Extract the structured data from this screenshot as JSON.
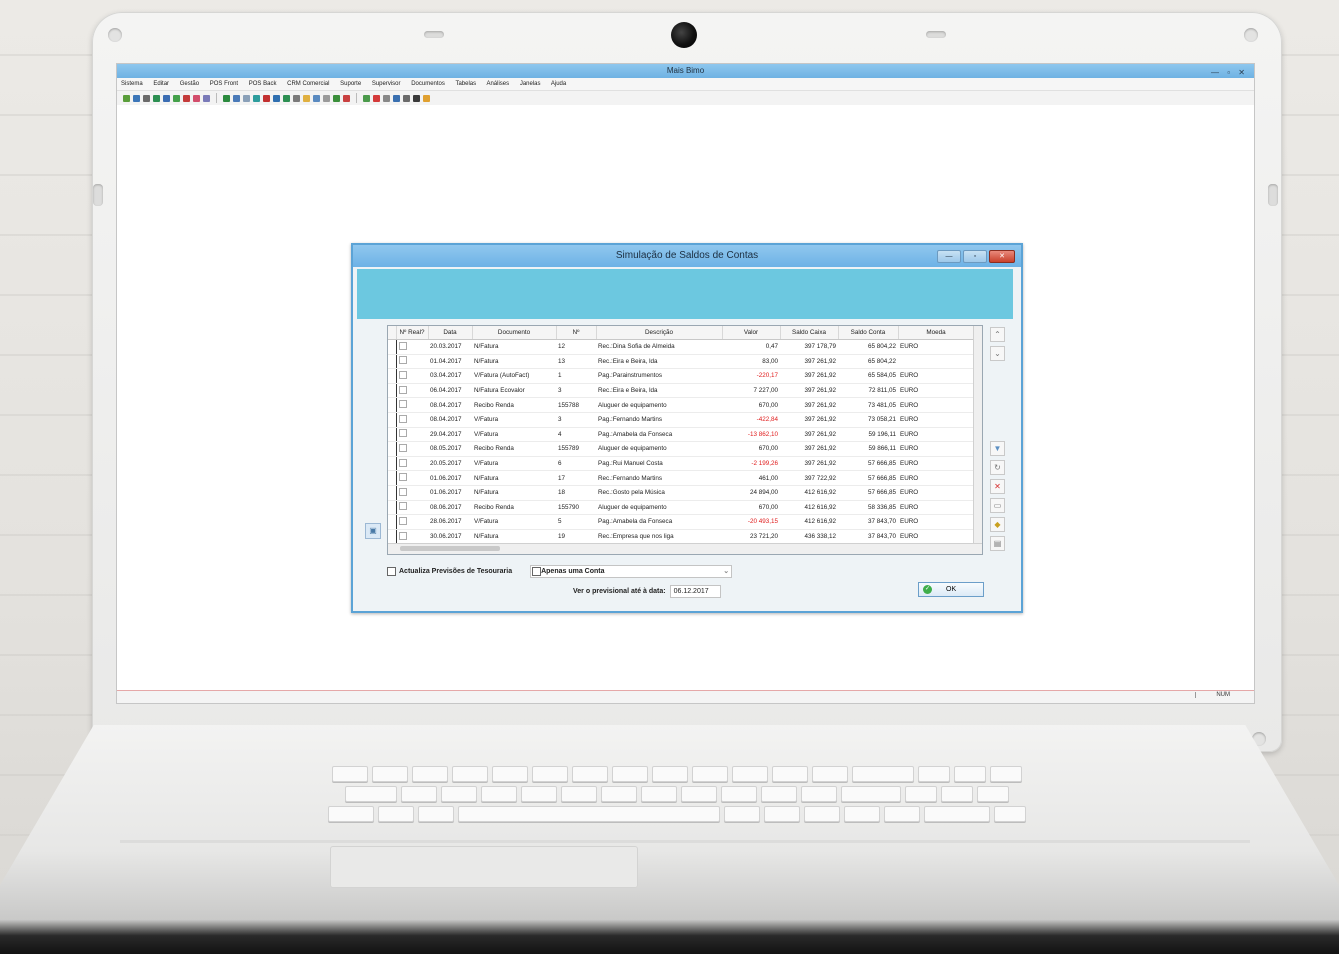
{
  "app": {
    "title": "Mais Bimo",
    "window_controls": "— ▫ ✕",
    "menu": [
      "Sistema",
      "Editar",
      "Gestão",
      "POS Front",
      "POS Back",
      "CRM Comercial",
      "Suporte",
      "Supervisor",
      "Documentos",
      "Tabelas",
      "Análises",
      "Janelas",
      "Ajuda"
    ],
    "status_right": "NUM"
  },
  "dialog": {
    "title": "Simulação de Saldos de Contas",
    "controls": {
      "minimize": "—",
      "maximize": "▫",
      "close": "✕"
    },
    "columns": [
      "Nº Real?",
      "Data",
      "Documento",
      "Nº",
      "Descrição",
      "Valor",
      "Saldo Caixa",
      "Saldo Conta",
      "Moeda"
    ],
    "rows": [
      {
        "data": "20.03.2017",
        "documento": "N/Fatura",
        "numero": "12",
        "descricao": "Rec.:Dina Sofia de Almeida",
        "valor": "0,47",
        "saldo_caixa": "397 178,79",
        "saldo_conta": "65 804,22",
        "moeda": "EURO",
        "neg": false
      },
      {
        "data": "01.04.2017",
        "documento": "N/Fatura",
        "numero": "13",
        "descricao": "Rec.:Eira e Beira, lda",
        "valor": "83,00",
        "saldo_caixa": "397 261,92",
        "saldo_conta": "65 804,22",
        "moeda": "",
        "neg": false
      },
      {
        "data": "03.04.2017",
        "documento": "V/Fatura (AutoFact)",
        "numero": "1",
        "descricao": "Pag.:Parainstrumentos",
        "valor": "-220,17",
        "saldo_caixa": "397 261,92",
        "saldo_conta": "65 584,05",
        "moeda": "EURO",
        "neg": true
      },
      {
        "data": "06.04.2017",
        "documento": "N/Fatura Ecovalor",
        "numero": "3",
        "descricao": "Rec.:Eira e Beira, lda",
        "valor": "7 227,00",
        "saldo_caixa": "397 261,92",
        "saldo_conta": "72 811,05",
        "moeda": "EURO",
        "neg": false
      },
      {
        "data": "08.04.2017",
        "documento": "Recibo Renda",
        "numero": "155788",
        "descricao": "Aluguer de equipamento",
        "valor": "670,00",
        "saldo_caixa": "397 261,92",
        "saldo_conta": "73 481,05",
        "moeda": "EURO",
        "neg": false
      },
      {
        "data": "08.04.2017",
        "documento": "V/Fatura",
        "numero": "3",
        "descricao": "Pag.:Fernando Martins",
        "valor": "-422,84",
        "saldo_caixa": "397 261,92",
        "saldo_conta": "73 058,21",
        "moeda": "EURO",
        "neg": true
      },
      {
        "data": "29.04.2017",
        "documento": "V/Fatura",
        "numero": "4",
        "descricao": "Pag.:Amabela da Fonseca",
        "valor": "-13 862,10",
        "saldo_caixa": "397 261,92",
        "saldo_conta": "59 196,11",
        "moeda": "EURO",
        "neg": true
      },
      {
        "data": "08.05.2017",
        "documento": "Recibo Renda",
        "numero": "155789",
        "descricao": "Aluguer de equipamento",
        "valor": "670,00",
        "saldo_caixa": "397 261,92",
        "saldo_conta": "59 866,11",
        "moeda": "EURO",
        "neg": false
      },
      {
        "data": "20.05.2017",
        "documento": "V/Fatura",
        "numero": "6",
        "descricao": "Pag.:Rui Manuel Costa",
        "valor": "-2 199,26",
        "saldo_caixa": "397 261,92",
        "saldo_conta": "57 666,85",
        "moeda": "EURO",
        "neg": true
      },
      {
        "data": "01.06.2017",
        "documento": "N/Fatura",
        "numero": "17",
        "descricao": "Rec.:Fernando Martins",
        "valor": "461,00",
        "saldo_caixa": "397 722,92",
        "saldo_conta": "57 666,85",
        "moeda": "EURO",
        "neg": false
      },
      {
        "data": "01.06.2017",
        "documento": "N/Fatura",
        "numero": "18",
        "descricao": "Rec.:Gosto pela Música",
        "valor": "24 894,00",
        "saldo_caixa": "412 616,92",
        "saldo_conta": "57 666,85",
        "moeda": "EURO",
        "neg": false
      },
      {
        "data": "08.06.2017",
        "documento": "Recibo Renda",
        "numero": "155790",
        "descricao": "Aluguer de equipamento",
        "valor": "670,00",
        "saldo_caixa": "412 616,92",
        "saldo_conta": "58 336,85",
        "moeda": "EURO",
        "neg": false
      },
      {
        "data": "28.06.2017",
        "documento": "V/Fatura",
        "numero": "5",
        "descricao": "Pag.:Amabela da Fonseca",
        "valor": "-20 493,15",
        "saldo_caixa": "412 616,92",
        "saldo_conta": "37 843,70",
        "moeda": "EURO",
        "neg": true
      },
      {
        "data": "30.06.2017",
        "documento": "N/Fatura",
        "numero": "19",
        "descricao": "Rec.:Empresa que nos liga",
        "valor": "23 721,20",
        "saldo_caixa": "436 338,12",
        "saldo_conta": "37 843,70",
        "moeda": "EURO",
        "neg": false
      }
    ],
    "options": {
      "update_forecasts": "Actualiza Previsões de Tesouraria",
      "only_one_account": "Apenas uma Conta"
    },
    "forecast_label": "Ver o previsional até à data:",
    "forecast_date": "06.12.2017",
    "ok_label": "OK"
  }
}
